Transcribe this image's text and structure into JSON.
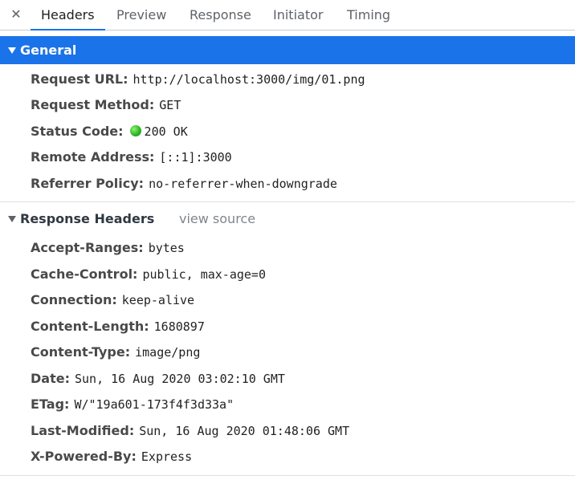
{
  "tabs": {
    "close_icon": "✕",
    "items": [
      {
        "label": "Headers"
      },
      {
        "label": "Preview"
      },
      {
        "label": "Response"
      },
      {
        "label": "Initiator"
      },
      {
        "label": "Timing"
      }
    ],
    "active": "Headers"
  },
  "general": {
    "title": "General",
    "rows": [
      {
        "name": "Request URL:",
        "value": "http://localhost:3000/img/01.png"
      },
      {
        "name": "Request Method:",
        "value": "GET"
      },
      {
        "name": "Status Code:",
        "value": "200 OK"
      },
      {
        "name": "Remote Address:",
        "value": "[::1]:3000"
      },
      {
        "name": "Referrer Policy:",
        "value": "no-referrer-when-downgrade"
      }
    ]
  },
  "response_headers": {
    "title": "Response Headers",
    "view_source": "view source",
    "rows": [
      {
        "name": "Accept-Ranges:",
        "value": "bytes"
      },
      {
        "name": "Cache-Control:",
        "value": "public, max-age=0"
      },
      {
        "name": "Connection:",
        "value": "keep-alive"
      },
      {
        "name": "Content-Length:",
        "value": "1680897"
      },
      {
        "name": "Content-Type:",
        "value": "image/png"
      },
      {
        "name": "Date:",
        "value": "Sun, 16 Aug 2020 03:02:10 GMT"
      },
      {
        "name": "ETag:",
        "value": "W/\"19a601-173f4f3d33a\""
      },
      {
        "name": "Last-Modified:",
        "value": "Sun, 16 Aug 2020 01:48:06 GMT"
      },
      {
        "name": "X-Powered-By:",
        "value": "Express"
      }
    ]
  },
  "colors": {
    "accent": "#1a73e8",
    "status_ok": "#2fb52a"
  },
  "icons": {
    "close": "close-icon",
    "expand": "triangle-down-icon",
    "status": "status-dot-icon"
  }
}
